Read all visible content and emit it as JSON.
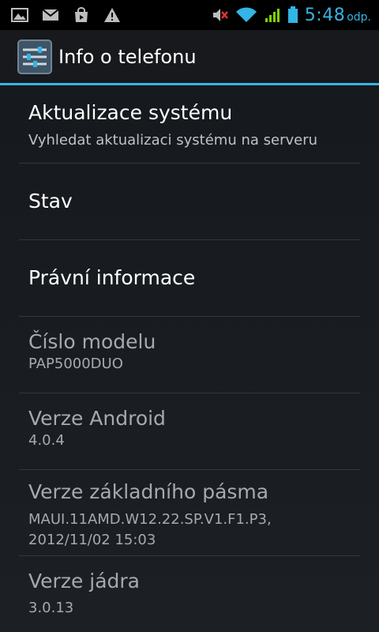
{
  "status_bar": {
    "left_icons": [
      "image-icon",
      "gmail-icon",
      "shop-bag-icon",
      "warning-icon"
    ],
    "right_icons": [
      "mute-icon",
      "wifi-icon",
      "signal-icon",
      "battery-icon"
    ],
    "time": "5:48",
    "ampm": "odp."
  },
  "action_bar": {
    "icon": "settings-icon",
    "title": "Info o telefonu"
  },
  "items": [
    {
      "title": "Aktualizace systému",
      "summary": "Vyhledat aktualizaci systému na serveru"
    },
    {
      "title": "Stav"
    },
    {
      "title": "Právní informace"
    },
    {
      "title": "Číslo modelu",
      "summary": "PAP5000DUO"
    },
    {
      "title": "Verze Android",
      "summary": "4.0.4"
    },
    {
      "title": "Verze základního pásma",
      "summary": "MAUI.11AMD.W12.22.SP.V1.F1.P3,",
      "summary2": "2012/11/02 15:03"
    },
    {
      "title": "Verze jádra",
      "summary": "3.0.13"
    }
  ],
  "colors": {
    "accent": "#33b5e5",
    "background": "#16191d"
  }
}
